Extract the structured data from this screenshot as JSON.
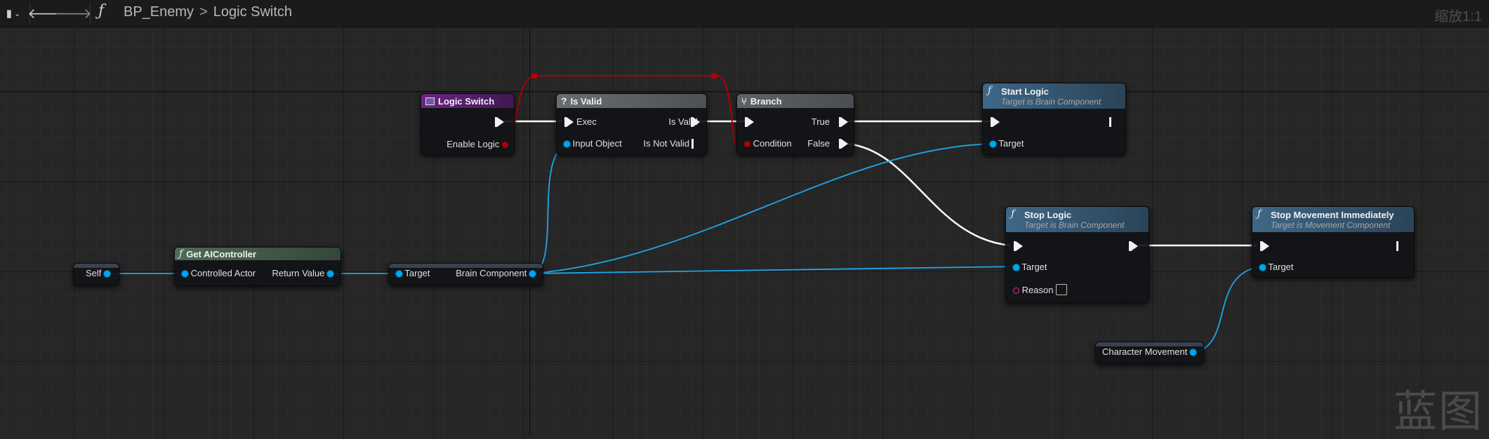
{
  "toolbar": {
    "breadcrumb_icon": "function-icon",
    "blueprint": "BP_Enemy",
    "separator": ">",
    "graph": "Logic Switch",
    "zoom": "缩放1:1"
  },
  "watermark": "蓝图",
  "colors": {
    "exec_wire": "#ffffff",
    "object_wire": "#1ea6e8",
    "logic_switch_header": "#5a1f70",
    "is_valid_header": "#5f6265",
    "branch_header": "#55595d",
    "function_header": "#3c6280",
    "pure_header": "#3c5244"
  },
  "nodes": {
    "logic_switch": {
      "title": "Logic Switch",
      "pin_enable": "Enable Logic"
    },
    "is_valid": {
      "title": "Is Valid",
      "pin_exec": "Exec",
      "pin_input": "Input Object",
      "pin_valid": "Is Valid",
      "pin_not_valid": "Is Not Valid"
    },
    "branch": {
      "title": "Branch",
      "pin_condition": "Condition",
      "pin_true": "True",
      "pin_false": "False"
    },
    "start_logic": {
      "title": "Start Logic",
      "subtitle": "Target is Brain Component",
      "pin_target": "Target"
    },
    "stop_logic": {
      "title": "Stop Logic",
      "subtitle": "Target is Brain Component",
      "pin_target": "Target",
      "pin_reason": "Reason"
    },
    "stop_movement": {
      "title": "Stop Movement Immediately",
      "subtitle": "Target is Movement Component",
      "pin_target": "Target"
    },
    "self": {
      "label": "Self"
    },
    "get_ai_controller": {
      "title": "Get AIController",
      "pin_in": "Controlled Actor",
      "pin_out": "Return Value"
    },
    "brain_component": {
      "pin_in": "Target",
      "pin_out": "Brain Component"
    },
    "character_movement": {
      "label": "Character Movement"
    }
  }
}
